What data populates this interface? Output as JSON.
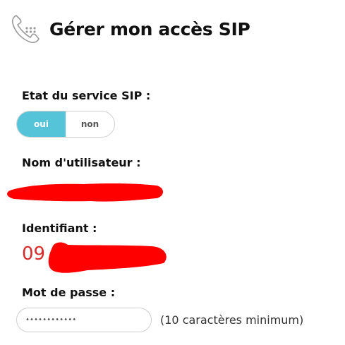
{
  "header": {
    "title": "Gérer mon accès SIP",
    "icon": "phone-keypad-icon"
  },
  "sip_state": {
    "label": "Etat du service SIP :",
    "options": [
      "oui",
      "non"
    ],
    "selected": "oui",
    "accent_color": "#55c4d8"
  },
  "username": {
    "label": "Nom d'utilisateur :"
  },
  "identifier": {
    "label": "Identifiant :",
    "visible_prefix": "09",
    "value_color": "#d62b2b"
  },
  "password": {
    "label": "Mot de passe :",
    "value": "••••••••••••",
    "hint": "(10 caractères minimum)"
  },
  "redaction_color": "#ff0000"
}
